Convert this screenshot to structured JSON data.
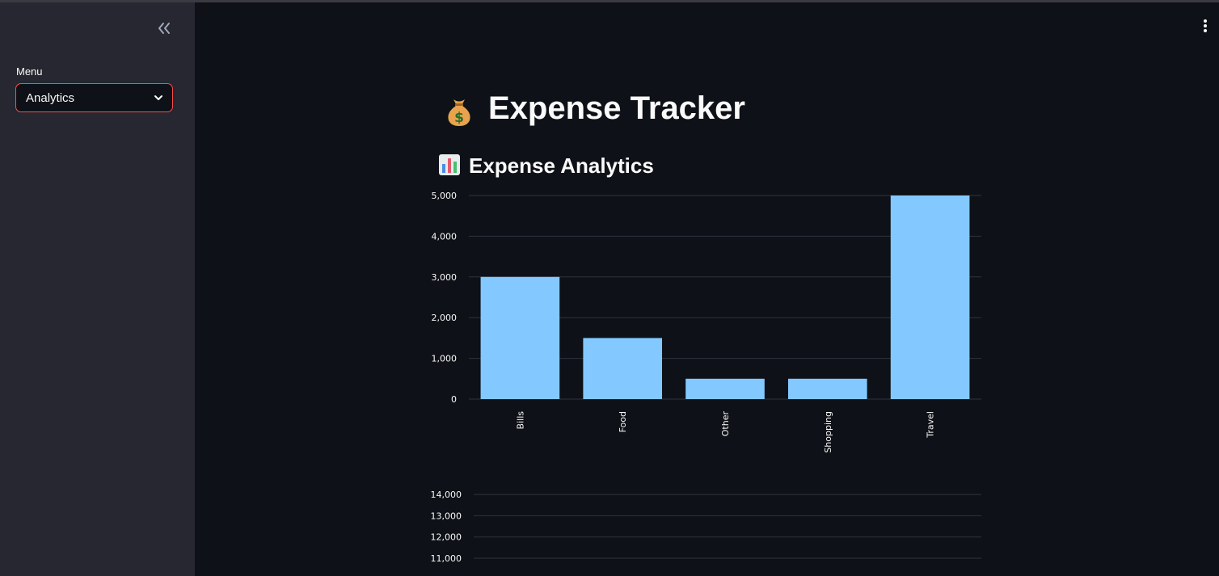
{
  "sidebar": {
    "menu_label": "Menu",
    "selected": "Analytics",
    "collapse_icon": "double-chevron-left-icon"
  },
  "main": {
    "title": "Expense Tracker",
    "title_icon": "money-bag-icon",
    "subtitle": "Expense Analytics",
    "subtitle_icon": "bar-chart-icon",
    "menu_icon": "kebab-menu-icon"
  },
  "colors": {
    "bar": "#83c9ff",
    "accent": "#ff4b4b",
    "background": "#0e1117",
    "sidebar": "#262730"
  },
  "chart_data": [
    {
      "type": "bar",
      "categories": [
        "Bills",
        "Food",
        "Other",
        "Shopping",
        "Travel"
      ],
      "values": [
        3000,
        1500,
        500,
        500,
        5000
      ],
      "yticks": [
        "0",
        "1,000",
        "2,000",
        "3,000",
        "4,000",
        "5,000"
      ],
      "ylim": [
        0,
        5000
      ],
      "grid": true
    },
    {
      "type": "bar",
      "categories": [],
      "values": [],
      "yticks": [
        "11,000",
        "12,000",
        "13,000",
        "14,000"
      ],
      "grid": true
    }
  ]
}
